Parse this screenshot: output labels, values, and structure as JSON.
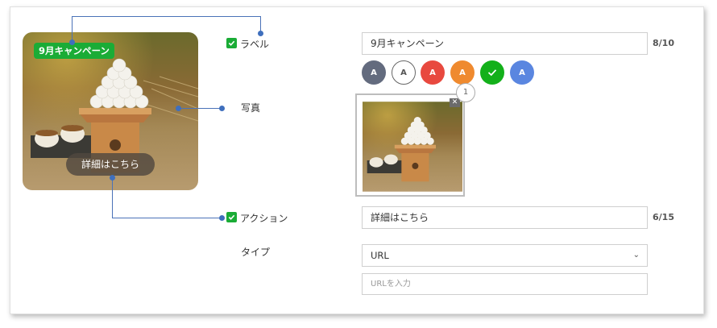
{
  "preview": {
    "badge_text": "9月キャンペーン",
    "action_text": "詳細はこちら"
  },
  "fields": {
    "label": {
      "checkbox_label": "ラベル",
      "value": "9月キャンペーン",
      "count": "8/10"
    },
    "photo": {
      "label": "写真",
      "step_number": "1"
    },
    "action": {
      "checkbox_label": "アクション",
      "value": "詳細はこちら",
      "count": "6/15"
    },
    "type": {
      "label": "タイプ",
      "selected": "URL",
      "url_placeholder": "URLを入力"
    }
  },
  "color_swatches": [
    {
      "letter": "A",
      "color": "#636b7e"
    },
    {
      "letter": "A",
      "color": "#ffffff"
    },
    {
      "letter": "A",
      "color": "#e8493f"
    },
    {
      "letter": "A",
      "color": "#ef8a2f"
    },
    {
      "letter": "",
      "color": "#13b01a",
      "selected": true
    },
    {
      "letter": "A",
      "color": "#5a86e0"
    }
  ],
  "colors": {
    "accent_green": "#1aac36",
    "connector_blue": "#4a72b8"
  }
}
